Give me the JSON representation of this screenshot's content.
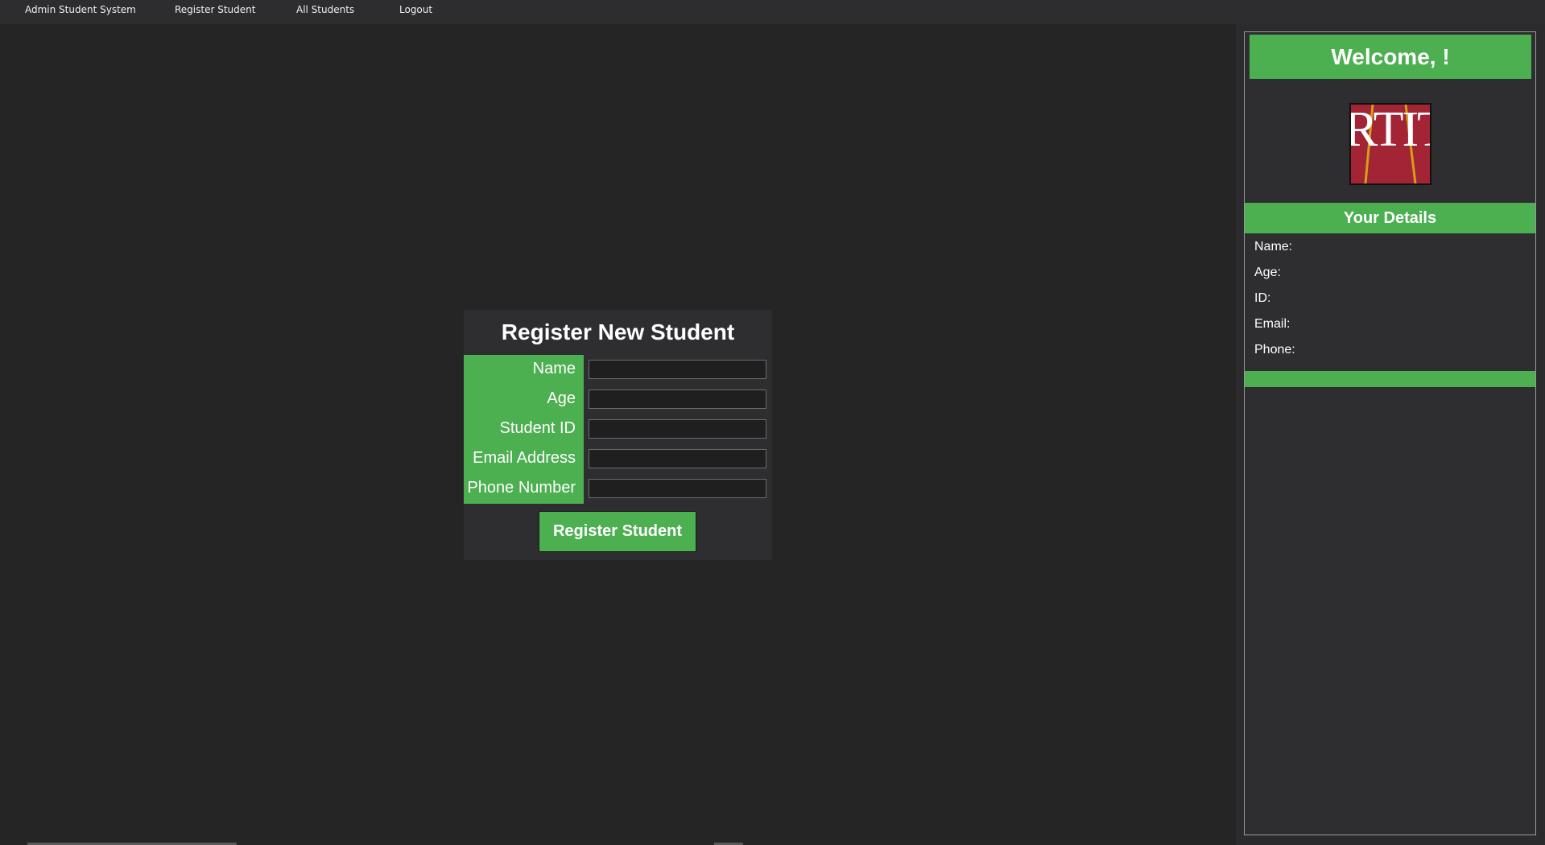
{
  "menubar": {
    "items": [
      "Admin Student System",
      "Register Student",
      "All Students",
      "Logout"
    ]
  },
  "form": {
    "title": "Register New Student",
    "fields": [
      {
        "label": "Name",
        "value": ""
      },
      {
        "label": "Age",
        "value": ""
      },
      {
        "label": "Student ID",
        "value": ""
      },
      {
        "label": "Email Address",
        "value": ""
      },
      {
        "label": "Phone Number",
        "value": ""
      }
    ],
    "submit_label": "Register Student"
  },
  "sidebar": {
    "welcome": "Welcome, !",
    "logo_text": "RTIT",
    "details_title": "Your Details",
    "details": [
      {
        "label": "Name:",
        "value": ""
      },
      {
        "label": "Age:",
        "value": ""
      },
      {
        "label": "ID:",
        "value": ""
      },
      {
        "label": "Email:",
        "value": ""
      },
      {
        "label": "Phone:",
        "value": ""
      }
    ]
  },
  "colors": {
    "accent": "#4caf50",
    "background": "#252525",
    "panel": "#2e2e30",
    "logo": "#a32434"
  }
}
